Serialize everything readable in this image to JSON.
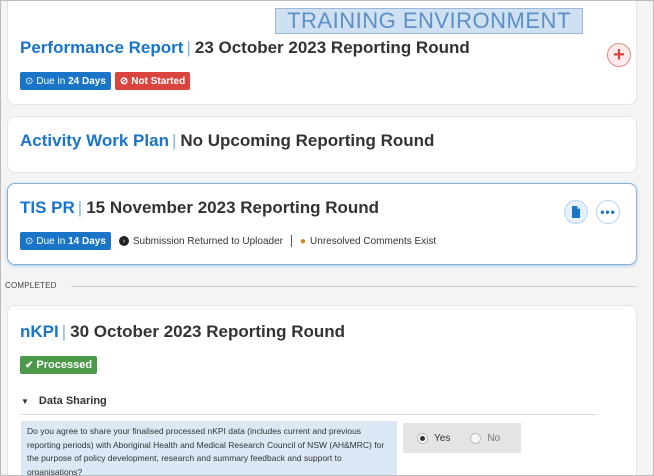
{
  "banner": "TRAINING ENVIRONMENT",
  "cards": {
    "performance_report": {
      "program": "Performance Report",
      "round": "23 October 2023 Reporting Round",
      "due_prefix": "Due in",
      "due_days": "24 Days",
      "status": "Not Started"
    },
    "activity_work_plan": {
      "program": "Activity Work Plan",
      "round": "No Upcoming Reporting Round"
    },
    "tis_pr": {
      "program": "TIS PR",
      "round": "15 November 2023 Reporting Round",
      "due_prefix": "Due in",
      "due_days": "14 Days",
      "status": "Submission Returned to Uploader",
      "comments": "Unresolved Comments Exist"
    },
    "nkpi": {
      "program": "nKPI",
      "round": "30 October 2023 Reporting Round",
      "status": "Processed"
    }
  },
  "section_label": "COMPLETED",
  "data_sharing": {
    "heading": "Data Sharing",
    "question": "Do you agree to share your finalised processed nKPI data (includes current and previous reporting periods) with Aboriginal Health and Medical Research Council of NSW (AH&MRC) for the purpose of policy development, research and summary feedback and support to organisations?",
    "options": [
      "Yes",
      "No"
    ],
    "selected": "Yes"
  },
  "colors": {
    "accent_blue": "#1a74c7",
    "danger_red": "#d9453e",
    "success_green": "#4a9a4a",
    "banner_bg": "#cfe0f2"
  },
  "icons": {
    "due": "clock-icon",
    "not_started": "ban-icon",
    "submission": "arrow-icon",
    "comments": "comment-icon",
    "processed": "check-icon",
    "add": "plus-icon",
    "document": "document-icon",
    "more": "ellipsis-icon",
    "collapse": "caret-down-icon"
  }
}
